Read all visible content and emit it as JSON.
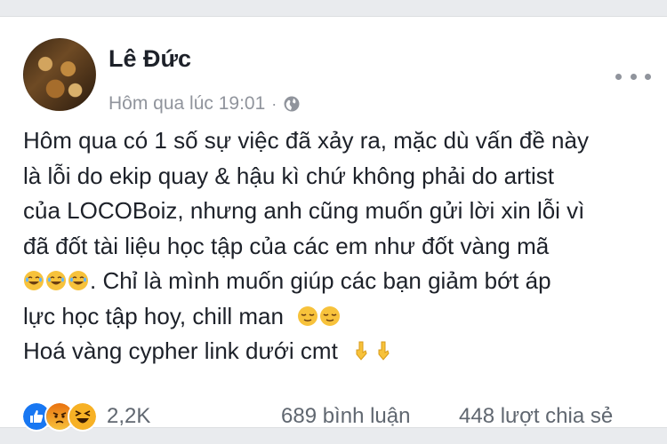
{
  "post": {
    "author": "Lê Đức",
    "timestamp": "Hôm qua lúc 19:01",
    "separator": "·",
    "privacy_icon": "globe-icon",
    "more_icon": "more-dots-icon",
    "lines": [
      "Hôm qua có 1 số sự việc đã xảy ra, mặc dù vấn đề này",
      "là lỗi do ekip quay & hậu kì chứ không phải do artist",
      "của LOCOBoiz, nhưng anh cũng muốn gửi lời xin lỗi vì",
      "đã đốt tài liệu học tập của các em như đốt vàng mã"
    ],
    "line5_text": ". Chỉ là mình muốn giúp các bạn giảm bớt áp",
    "line6_text": "lực học tập hoy, chill man",
    "line7_text": "Hoá vàng cypher link dưới cmt",
    "emojis": {
      "line5": [
        "joy-emoji",
        "joy-emoji",
        "joy-emoji"
      ],
      "line6": [
        "relieved-emoji",
        "relieved-emoji"
      ],
      "line7": [
        "pointing-down-emoji",
        "pointing-down-emoji"
      ]
    }
  },
  "footer": {
    "reactions": [
      "like-reaction-icon",
      "angry-reaction-icon",
      "haha-reaction-icon"
    ],
    "reaction_count": "2,2K",
    "comments": "689 bình luận",
    "shares": "448 lượt chia sẻ"
  },
  "colors": {
    "background": "#e9ebee",
    "card": "#ffffff",
    "text": "#1d2129",
    "meta": "#90949c",
    "like_blue": "#1877f2",
    "angry_orange": "#e9710f",
    "haha_yellow": "#f7b125"
  }
}
